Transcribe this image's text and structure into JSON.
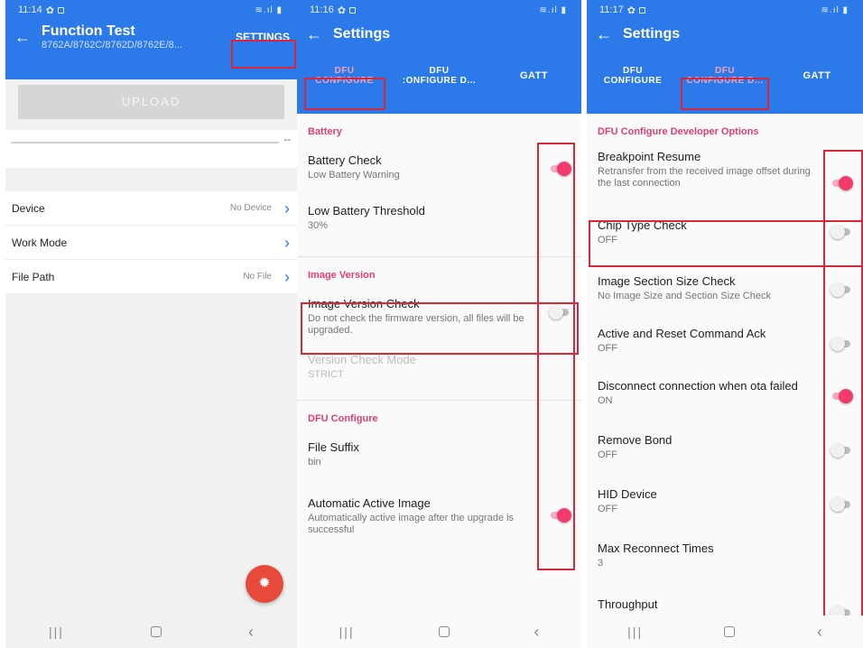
{
  "panel1": {
    "time": "11:14",
    "title": "Function Test",
    "subtitle": "8762A/8762C/8762D/8762E/8...",
    "settings_label": "SETTINGS",
    "upload_label": "UPLOAD",
    "progress_text": "--",
    "rows": [
      {
        "label": "Device",
        "value": "No Device"
      },
      {
        "label": "Work Mode",
        "value": ""
      },
      {
        "label": "File Path",
        "value": "No File"
      }
    ],
    "fab_icon": "gear-icon"
  },
  "panel2": {
    "time": "11:16",
    "title": "Settings",
    "tabs": {
      "t1a": "DFU",
      "t1b": "CONFIGURE",
      "t2a": "DFU",
      "t2b": ":ONFIGURE D...",
      "t3": "GATT"
    },
    "sections": {
      "battery": "Battery",
      "image_version": "Image Version",
      "dfu_configure": "DFU Configure"
    },
    "prefs": {
      "battery_check": {
        "title": "Battery Check",
        "summary": "Low Battery Warning",
        "on": true
      },
      "low_battery": {
        "title": "Low Battery Threshold",
        "summary": "30%"
      },
      "image_version_check": {
        "title": "Image Version Check",
        "summary": "Do not check the firmware version, all files will be upgraded.",
        "on": false
      },
      "version_check_mode": {
        "title": "Version Check Mode",
        "summary": "STRICT"
      },
      "file_suffix": {
        "title": "File Suffix",
        "summary": "bin"
      },
      "auto_active": {
        "title": "Automatic Active Image",
        "summary": "Automatically active image after the upgrade is successful",
        "on": true
      }
    }
  },
  "panel3": {
    "time": "11:17",
    "title": "Settings",
    "tabs": {
      "t1a": "DFU",
      "t1b": "CONFIGURE",
      "t2a": "DFU",
      "t2b": "CONFIGURE D...",
      "t3": "GATT"
    },
    "section": "DFU Configure Developer Options",
    "prefs": {
      "breakpoint": {
        "title": "Breakpoint Resume",
        "summary": "Retransfer from the received image offset during the last connection",
        "on": true
      },
      "chip_type": {
        "title": "Chip Type Check",
        "summary": "OFF",
        "on": false
      },
      "image_section": {
        "title": "Image Section Size Check",
        "summary": "No Image Size and Section Size Check",
        "on": false
      },
      "active_reset": {
        "title": "Active and Reset Command Ack",
        "summary": "OFF",
        "on": false
      },
      "disconnect": {
        "title": "Disconnect connection when ota failed",
        "summary": "ON",
        "on": true
      },
      "remove_bond": {
        "title": "Remove Bond",
        "summary": "OFF",
        "on": false
      },
      "hid_device": {
        "title": "HID Device",
        "summary": "OFF",
        "on": false
      },
      "max_reconnect": {
        "title": "Max Reconnect Times",
        "summary": "3"
      },
      "throughput": {
        "title": "Throughput",
        "on": false
      }
    }
  },
  "colors": {
    "appbar": "#2c79ea",
    "accent": "#f43a6b",
    "highlight_box": "#d8263a",
    "fab": "#e74a3b"
  }
}
